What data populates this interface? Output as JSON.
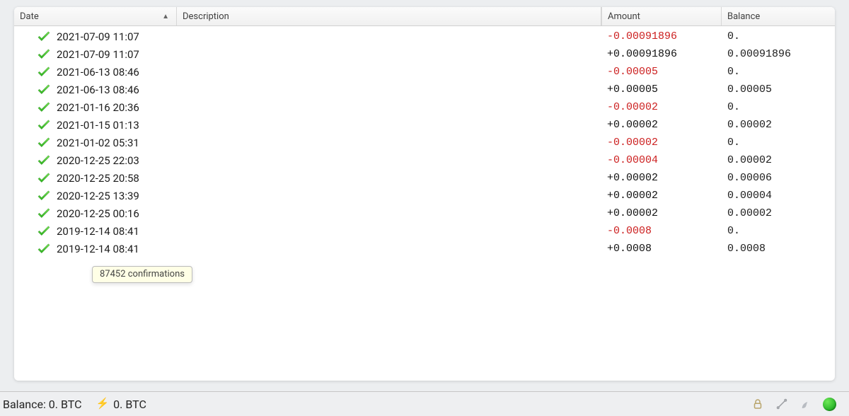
{
  "columns": {
    "date": "Date",
    "description": "Description",
    "amount": "Amount",
    "balance": "Balance",
    "sort_indicator": "▲"
  },
  "transactions": [
    {
      "date": "2021-07-09 11:07",
      "desc": "",
      "amount": "-0.00091896",
      "sign": "neg",
      "balance": "0."
    },
    {
      "date": "2021-07-09 11:07",
      "desc": "",
      "amount": "+0.00091896",
      "sign": "pos",
      "balance": "0.00091896"
    },
    {
      "date": "2021-06-13 08:46",
      "desc": "",
      "amount": "-0.00005",
      "sign": "neg",
      "balance": "0."
    },
    {
      "date": "2021-06-13 08:46",
      "desc": "",
      "amount": "+0.00005",
      "sign": "pos",
      "balance": "0.00005"
    },
    {
      "date": "2021-01-16 20:36",
      "desc": "",
      "amount": "-0.00002",
      "sign": "neg",
      "balance": "0."
    },
    {
      "date": "2021-01-15 01:13",
      "desc": "",
      "amount": "+0.00002",
      "sign": "pos",
      "balance": "0.00002"
    },
    {
      "date": "2021-01-02 05:31",
      "desc": "",
      "amount": "-0.00002",
      "sign": "neg",
      "balance": "0."
    },
    {
      "date": "2020-12-25 22:03",
      "desc": "",
      "amount": "-0.00004",
      "sign": "neg",
      "balance": "0.00002"
    },
    {
      "date": "2020-12-25 20:58",
      "desc": "",
      "amount": "+0.00002",
      "sign": "pos",
      "balance": "0.00006"
    },
    {
      "date": "2020-12-25 13:39",
      "desc": "",
      "amount": "+0.00002",
      "sign": "pos",
      "balance": "0.00004"
    },
    {
      "date": "2020-12-25 00:16",
      "desc": "",
      "amount": "+0.00002",
      "sign": "pos",
      "balance": "0.00002"
    },
    {
      "date": "2019-12-14 08:41",
      "desc": "",
      "amount": "-0.0008",
      "sign": "neg",
      "balance": "0."
    },
    {
      "date": "2019-12-14 08:41",
      "desc": "",
      "amount": "+0.0008",
      "sign": "pos",
      "balance": "0.0008"
    }
  ],
  "tooltip": "87452 confirmations",
  "statusbar": {
    "balance_label": "Balance: 0. BTC",
    "lightning_label": "0. BTC"
  }
}
